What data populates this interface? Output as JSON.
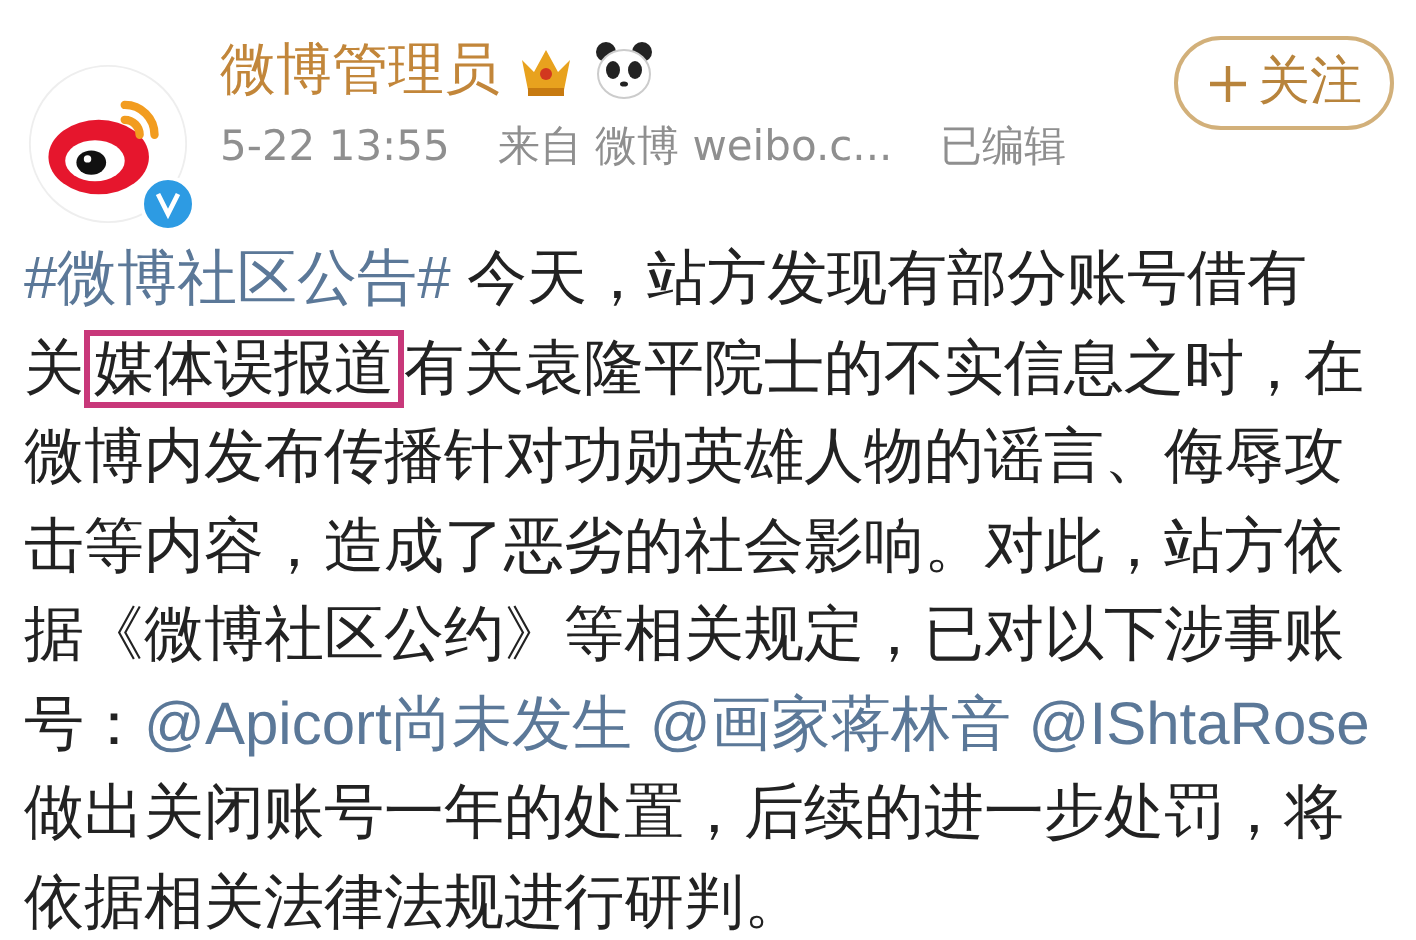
{
  "author": {
    "name": "微博管理员",
    "verified": true
  },
  "follow_button": {
    "label": "关注"
  },
  "meta": {
    "time": "5-22 13:55",
    "source": "来自 微博 weibo.c...",
    "edited": "已编辑"
  },
  "post": {
    "lines": [
      [
        {
          "kind": "hashtag",
          "text": "#微博社区公告#"
        },
        {
          "kind": "text",
          "text": " 今天，站方发现有部分账号借有"
        }
      ],
      [
        {
          "kind": "text",
          "text": "关"
        },
        {
          "kind": "boxed",
          "text": "媒体误报道"
        },
        {
          "kind": "text",
          "text": "有关袁隆平院士的不实信息之时，在"
        }
      ],
      [
        {
          "kind": "text",
          "text": "微博内发布传播针对功勋英雄人物的谣言、侮辱攻"
        }
      ],
      [
        {
          "kind": "text",
          "text": "击等内容，造成了恶劣的社会影响。对此，站方依"
        }
      ],
      [
        {
          "kind": "text",
          "text": "据《微博社区公约》等相关规定，已对以下涉事账"
        }
      ],
      [
        {
          "kind": "text",
          "text": "号："
        },
        {
          "kind": "mention",
          "text": "@Apicort尚未发生"
        },
        {
          "kind": "mention",
          "text": "@画家蒋林音"
        },
        {
          "kind": "mention",
          "text": "@IShtaRose"
        }
      ],
      [
        {
          "kind": "text",
          "text": "做出关闭账号一年的处置，后续的进一步处罚，将"
        }
      ],
      [
        {
          "kind": "text",
          "text": "依据相关法律法规进行研判。"
        }
      ]
    ]
  }
}
